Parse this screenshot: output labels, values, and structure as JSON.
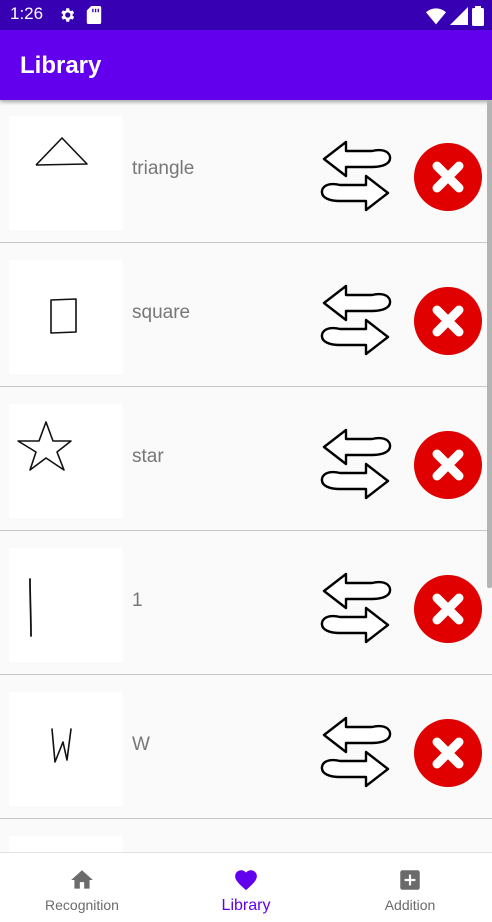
{
  "status_bar": {
    "time": "1:26"
  },
  "app_bar": {
    "title": "Library"
  },
  "items": [
    {
      "label": "triangle",
      "drawing": "triangle"
    },
    {
      "label": "square",
      "drawing": "square"
    },
    {
      "label": "star",
      "drawing": "star"
    },
    {
      "label": "1",
      "drawing": "one"
    },
    {
      "label": "W",
      "drawing": "w"
    }
  ],
  "bottom_nav": [
    {
      "label": "Recognition",
      "icon": "home-icon",
      "active": false
    },
    {
      "label": "Library",
      "icon": "heart-icon",
      "active": true
    },
    {
      "label": "Addition",
      "icon": "add-box-icon",
      "active": false
    }
  ],
  "colors": {
    "status_bar": "#3700b3",
    "app_bar": "#6200ee",
    "delete": "#e10000",
    "active_nav": "#6200ee"
  }
}
